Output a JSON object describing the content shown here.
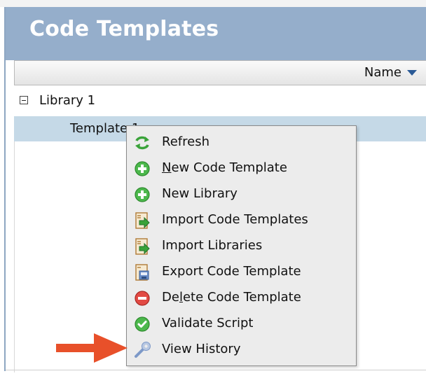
{
  "panel": {
    "title": "Code Templates"
  },
  "table": {
    "column_name": "Name",
    "rows": [
      {
        "label": "Library 1",
        "type": "library",
        "expanded": true
      },
      {
        "label": "Template 1",
        "type": "template",
        "selected": true
      }
    ]
  },
  "context_menu": {
    "items": [
      {
        "pre": "",
        "u": "",
        "post": "Refresh",
        "icon": "refresh-icon"
      },
      {
        "pre": "",
        "u": "N",
        "post": "ew Code Template",
        "icon": "add-icon"
      },
      {
        "pre": "",
        "u": "",
        "post": "New Library",
        "icon": "add-icon"
      },
      {
        "pre": "",
        "u": "",
        "post": "Import Code Templates",
        "icon": "import-icon"
      },
      {
        "pre": "",
        "u": "",
        "post": "Import Libraries",
        "icon": "import-icon"
      },
      {
        "pre": "",
        "u": "",
        "post": "Export Code Template",
        "icon": "export-icon"
      },
      {
        "pre": "De",
        "u": "l",
        "post": "ete Code Template",
        "icon": "delete-icon"
      },
      {
        "pre": "",
        "u": "",
        "post": "Validate Script",
        "icon": "validate-icon"
      },
      {
        "pre": "",
        "u": "",
        "post": "View History",
        "icon": "wrench-icon"
      }
    ]
  },
  "colors": {
    "header_bg": "#95aecb",
    "selected_row": "#c5d9e7",
    "menu_bg": "#ececec",
    "annotation_arrow": "#e8502a"
  }
}
